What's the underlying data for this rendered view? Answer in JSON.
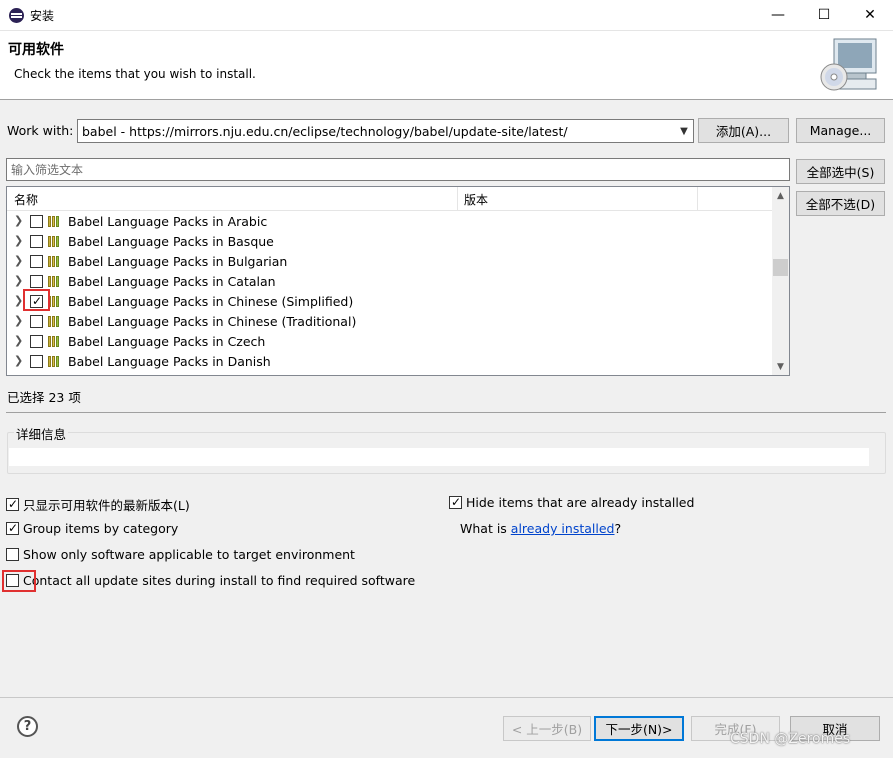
{
  "window": {
    "title": "安装",
    "minimize": "—",
    "maximize": "☐",
    "close": "✕"
  },
  "header": {
    "title": "可用软件",
    "subtitle": "Check the items that you wish to install."
  },
  "work_with": {
    "label": "Work with:",
    "value": "babel - https://mirrors.nju.edu.cn/eclipse/technology/babel/update-site/latest/",
    "add_button": "添加(A)...",
    "manage_button": "Manage..."
  },
  "filter": {
    "placeholder": "输入筛选文本"
  },
  "side_buttons": {
    "select_all": "全部选中(S)",
    "deselect_all": "全部不选(D)"
  },
  "table": {
    "columns": [
      "名称",
      "版本"
    ],
    "rows": [
      {
        "label": "Babel Language Packs in Arabic",
        "checked": false
      },
      {
        "label": "Babel Language Packs in Basque",
        "checked": false
      },
      {
        "label": "Babel Language Packs in Bulgarian",
        "checked": false
      },
      {
        "label": "Babel Language Packs in Catalan",
        "checked": false
      },
      {
        "label": "Babel Language Packs in Chinese (Simplified)",
        "checked": true
      },
      {
        "label": "Babel Language Packs in Chinese (Traditional)",
        "checked": false
      },
      {
        "label": "Babel Language Packs in Czech",
        "checked": false
      },
      {
        "label": "Babel Language Packs in Danish",
        "checked": false
      }
    ]
  },
  "selection_count": "已选择 23 项",
  "details": {
    "title": "详细信息"
  },
  "options": {
    "latest_only": {
      "label": "只显示可用软件的最新版本(L)",
      "checked": true
    },
    "group_by_category": {
      "label": "Group items by category",
      "checked": true
    },
    "target_env": {
      "label": "Show only software applicable to target environment",
      "checked": false
    },
    "contact_sites": {
      "label": "Contact all update sites during install to find required software",
      "checked": false
    },
    "hide_installed": {
      "label": "Hide items that are already installed",
      "checked": true
    },
    "what_is_prefix": "What is ",
    "what_is_link": "already installed",
    "what_is_suffix": "?"
  },
  "footer": {
    "back": "< 上一步(B)",
    "next": "下一步(N)>",
    "finish": "完成(F)",
    "cancel": "取消"
  },
  "watermark": "CSDN @Zeromes",
  "colors": {
    "highlight_box": "#e03030",
    "link": "#0044cc",
    "focus": "#0078d7"
  }
}
